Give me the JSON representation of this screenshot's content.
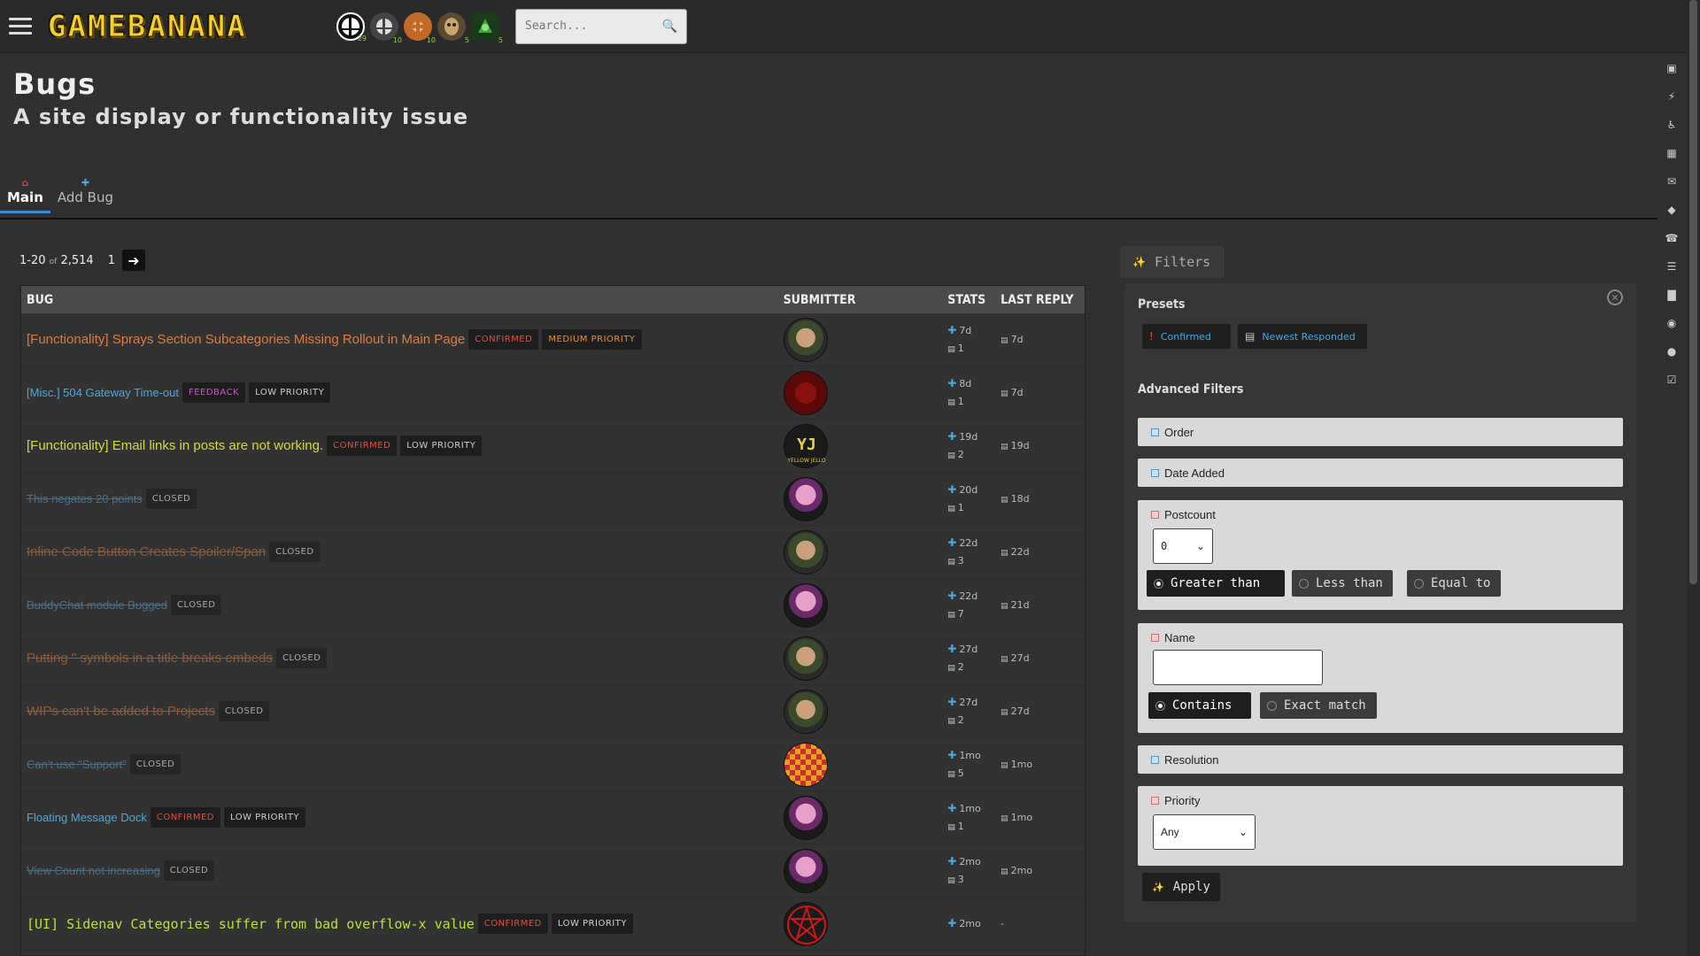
{
  "header": {
    "logo_text": "GAMEBANANA",
    "search_placeholder": "Search...",
    "games": [
      {
        "name": "Super Smash Bros. Ultimate",
        "count": "29",
        "color": "#ffffff"
      },
      {
        "name": "Super Smash Bros. Melee",
        "count": "10",
        "color": "#dddddd"
      },
      {
        "name": "Team Fortress 2",
        "count": "10",
        "color": "#c2692a"
      },
      {
        "name": "Half-Life",
        "count": "5",
        "color": "#c9a56a"
      },
      {
        "name": "Counter-Strike",
        "count": "5",
        "color": "#3ea23e"
      }
    ]
  },
  "page": {
    "title": "Bugs",
    "subtitle": "A site display or functionality issue"
  },
  "tabs": [
    {
      "label": "Main",
      "icon": "home-icon",
      "active": true
    },
    {
      "label": "Add Bug",
      "icon": "plus-icon",
      "active": false
    }
  ],
  "pager": {
    "range": "1-20",
    "of": "of",
    "total": "2,514",
    "page": "1"
  },
  "table": {
    "headers": {
      "bug": "BUG",
      "submitter": "SUBMITTER",
      "stats": "STATS",
      "last_reply": "LAST REPLY"
    },
    "rows": [
      {
        "title": "[Functionality] Sprays Section Subcategories Missing Rollout in Main Page",
        "style": "orange",
        "tags": [
          {
            "t": "CONFIRMED",
            "c": "confirmed"
          },
          {
            "t": "MEDIUM PRIORITY",
            "c": "medium"
          }
        ],
        "avatar": "soldier",
        "added": "7d",
        "posts": "1",
        "reply": "7d"
      },
      {
        "title": "[Misc.] 504 Gateway Time-out",
        "style": "blue",
        "tags": [
          {
            "t": "FEEDBACK",
            "c": "feedback"
          },
          {
            "t": "LOW PRIORITY",
            "c": "low"
          }
        ],
        "avatar": "red",
        "added": "8d",
        "posts": "1",
        "reply": "7d"
      },
      {
        "title": "[Functionality] Email links in posts are not working.",
        "style": "yellow",
        "tags": [
          {
            "t": "CONFIRMED",
            "c": "confirmed"
          },
          {
            "t": "LOW PRIORITY",
            "c": "low"
          }
        ],
        "avatar": "yellow",
        "added": "19d",
        "posts": "2",
        "reply": "19d"
      },
      {
        "title": "This negates 20 points",
        "style": "blue closed",
        "tags": [
          {
            "t": "CLOSED",
            "c": "closed"
          }
        ],
        "avatar": "pink",
        "added": "20d",
        "posts": "1",
        "reply": "18d"
      },
      {
        "title": "Inline Code Button Creates Spoiler/Span",
        "style": "orange closed",
        "tags": [
          {
            "t": "CLOSED",
            "c": "closed"
          }
        ],
        "avatar": "soldier",
        "added": "22d",
        "posts": "3",
        "reply": "22d"
      },
      {
        "title": "BuddyChat module Bugged",
        "style": "blue closed",
        "tags": [
          {
            "t": "CLOSED",
            "c": "closed"
          }
        ],
        "avatar": "pink",
        "added": "22d",
        "posts": "7",
        "reply": "21d"
      },
      {
        "title": "Putting \" symbols in a title breaks embeds",
        "style": "orange closed",
        "tags": [
          {
            "t": "CLOSED",
            "c": "closed"
          }
        ],
        "avatar": "soldier",
        "added": "27d",
        "posts": "2",
        "reply": "27d"
      },
      {
        "title": "WIPs can't be added to Projects",
        "style": "orange closed",
        "tags": [
          {
            "t": "CLOSED",
            "c": "closed"
          }
        ],
        "avatar": "soldier",
        "added": "27d",
        "posts": "2",
        "reply": "27d"
      },
      {
        "title": "Can't use \"Support\"",
        "style": "blue closed",
        "tags": [
          {
            "t": "CLOSED",
            "c": "closed"
          }
        ],
        "avatar": "checker",
        "added": "1mo",
        "posts": "5",
        "reply": "1mo"
      },
      {
        "title": "Floating Message Dock",
        "style": "blue",
        "tags": [
          {
            "t": "CONFIRMED",
            "c": "confirmed"
          },
          {
            "t": "LOW PRIORITY",
            "c": "low"
          }
        ],
        "avatar": "pink",
        "added": "1mo",
        "posts": "1",
        "reply": "1mo"
      },
      {
        "title": "View Count not increasing",
        "style": "blue closed",
        "tags": [
          {
            "t": "CLOSED",
            "c": "closed"
          }
        ],
        "avatar": "pink",
        "added": "2mo",
        "posts": "3",
        "reply": "2mo"
      },
      {
        "title": "[UI] Sidenav Categories suffer from bad overflow-x value",
        "style": "green",
        "tags": [
          {
            "t": "CONFIRMED",
            "c": "confirmed"
          },
          {
            "t": "LOW PRIORITY",
            "c": "low"
          }
        ],
        "avatar": "pentagram",
        "added": "2mo",
        "posts": "",
        "reply": "-"
      }
    ]
  },
  "filters": {
    "button_label": "Filters",
    "presets_title": "Presets",
    "presets": [
      {
        "label": "Confirmed",
        "icon": "exclamation-icon"
      },
      {
        "label": "Newest Responded",
        "icon": "comment-icon"
      }
    ],
    "advanced_title": "Advanced Filters",
    "order_label": "Order",
    "date_added_label": "Date Added",
    "postcount_label": "Postcount",
    "postcount_value": "0",
    "postcount_modes": [
      "Greater than",
      "Less than",
      "Equal to"
    ],
    "name_label": "Name",
    "name_value": "",
    "name_modes": [
      "Contains",
      "Exact match"
    ],
    "resolution_label": "Resolution",
    "priority_label": "Priority",
    "priority_value": "Any",
    "apply_label": "Apply"
  },
  "colors": {
    "accent_blue": "#4aa7e0",
    "confirmed_red": "#f04a3a",
    "medium_orange": "#f0902a",
    "feedback_magenta": "#d050d0",
    "logo_yellow": "#f7d02a"
  }
}
